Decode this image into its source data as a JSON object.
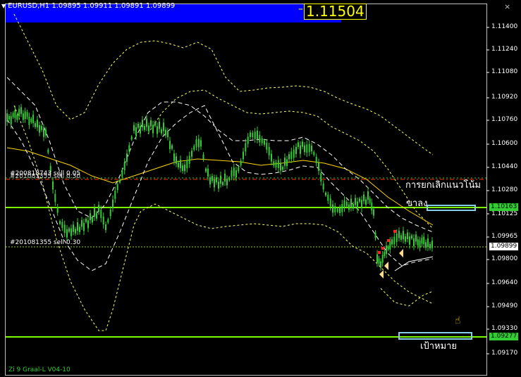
{
  "header": {
    "symbol_info": "EURUSD,H1  1.09895 1.09911 1.09891 1.09899",
    "big_price": "1.11504",
    "minimize": "–",
    "close": "×"
  },
  "axis": {
    "ticks": [
      "1.11400",
      "1.11240",
      "1.11080",
      "1.10920",
      "1.10760",
      "1.10600",
      "1.10440",
      "1.10280",
      "1.10125",
      "1.09965",
      "1.09800",
      "1.09640",
      "1.09490",
      "1.09330",
      "1.09170"
    ]
  },
  "price_tags": {
    "upper_level": "1.10163",
    "current": "1.09899",
    "target_level": "1.09277"
  },
  "orders": {
    "upper_label_a": "#200818743 sell 0.05",
    "upper_label_b": "#201081355 sell 0.30",
    "lower_label": "#201081355 sell 0.30"
  },
  "annotations": {
    "cancel_text": "การยกเลิกแนวโน้ม",
    "down_text": "ขาลง",
    "target_text": "เป้าหมาย"
  },
  "indicator": "Zi 9 Graal-L V04-10",
  "colors": {
    "candle": "#32cd32",
    "level_line": "#7cfc00",
    "band": "#ffff66",
    "white_band": "#ffffff",
    "box": "#87ceeb",
    "banner": "#0000ff"
  }
}
